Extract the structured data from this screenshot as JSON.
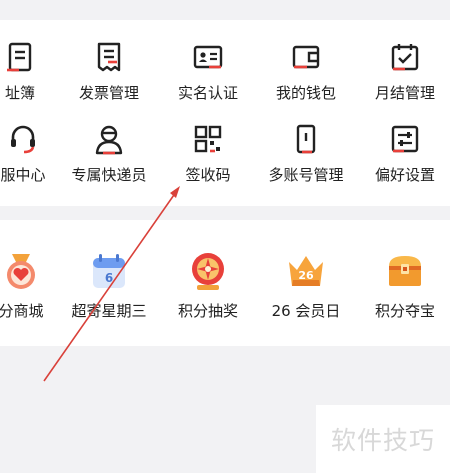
{
  "services": {
    "row1": [
      {
        "label": "址簿",
        "icon": "address-book-icon"
      },
      {
        "label": "发票管理",
        "icon": "invoice-icon"
      },
      {
        "label": "实名认证",
        "icon": "id-card-icon"
      },
      {
        "label": "我的钱包",
        "icon": "wallet-icon"
      },
      {
        "label": "月结管理",
        "icon": "calendar-check-icon"
      }
    ],
    "row2": [
      {
        "label": "服中心",
        "icon": "headset-icon"
      },
      {
        "label": "专属快递员",
        "icon": "courier-icon"
      },
      {
        "label": "签收码",
        "icon": "qr-code-icon"
      },
      {
        "label": "多账号管理",
        "icon": "phone-account-icon"
      },
      {
        "label": "偏好设置",
        "icon": "settings-sliders-icon"
      }
    ]
  },
  "rewards": {
    "items": [
      {
        "label": "分商城",
        "icon": "heart-medal-icon"
      },
      {
        "label": "超寄星期三",
        "icon": "calendar-6-icon",
        "badge": "6"
      },
      {
        "label": "积分抽奖",
        "icon": "lucky-wheel-icon"
      },
      {
        "label": "26 会员日",
        "icon": "crown-26-icon",
        "badge": "26"
      },
      {
        "label": "积分夺宝",
        "icon": "treasure-chest-icon"
      }
    ]
  },
  "watermark": {
    "text": "软件技巧"
  },
  "colors": {
    "accent": "#e8403a",
    "icon_stroke": "#222222",
    "arrow": "#d9413a"
  }
}
